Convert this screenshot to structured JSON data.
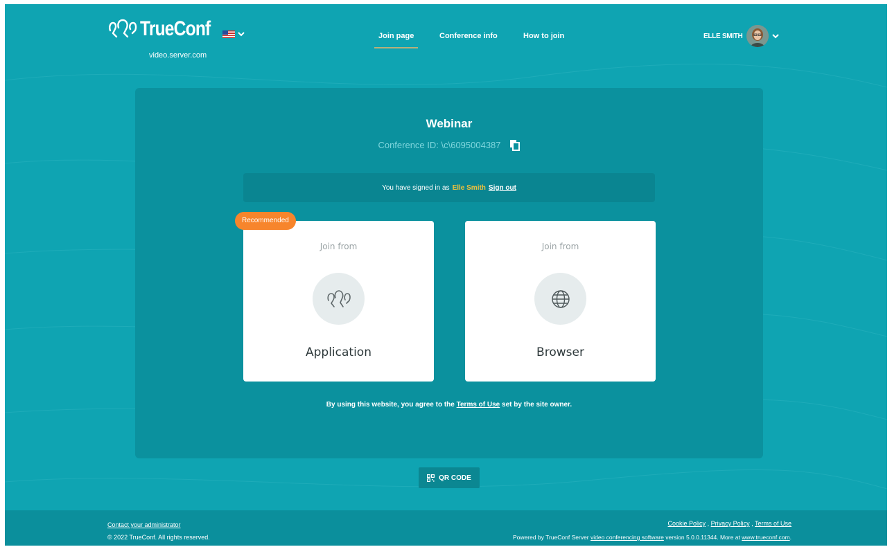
{
  "brand": {
    "logo_text": "TrueConf",
    "server": "video.server.com"
  },
  "language": {
    "flag": "us-flag-icon"
  },
  "nav": {
    "join_page": "Join page",
    "conference_info": "Conference info",
    "how_to_join": "How to join"
  },
  "user": {
    "name": "ELLE SMITH"
  },
  "conference": {
    "title": "Webinar",
    "id_text": "Conference ID: \\c\\6095004387"
  },
  "signin": {
    "prefix": "You have signed in as",
    "user": "Elle Smith",
    "signout": "Sign out"
  },
  "cards": {
    "badge": "Recommended",
    "app": {
      "from": "Join from",
      "label": "Application",
      "icon": "trueconf-icon"
    },
    "browser": {
      "from": "Join from",
      "label": "Browser",
      "icon": "globe-icon"
    }
  },
  "terms": {
    "prefix": "By using this website, you agree to the",
    "link": "Terms of Use",
    "suffix": "set by the site owner."
  },
  "qr": {
    "label": "QR CODE"
  },
  "footer": {
    "contact": "Contact your administrator",
    "copyright": "© 2022 TrueConf. All rights reserved.",
    "cookie": "Cookie Policy",
    "privacy": "Privacy Policy",
    "terms": "Terms of Use",
    "sep": ",",
    "powered_prefix": "Powered by TrueConf Server",
    "powered_link": "video conferencing software",
    "powered_version": "version 5.0.0.11344. More at",
    "site_link": "www.trueconf.com",
    "end": "."
  },
  "colors": {
    "background": "#0fa4b2",
    "panel": "#0b919e",
    "badge": "#f7852c",
    "highlight_user": "#f2c23b"
  }
}
